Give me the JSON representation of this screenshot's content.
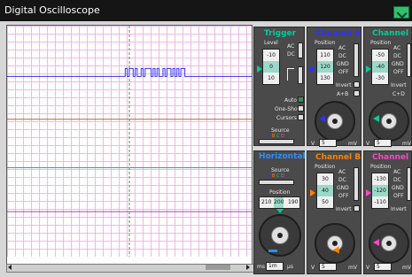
{
  "window": {
    "title": "Digital Oscilloscope"
  },
  "colors": {
    "channel_a": "#3030ff",
    "channel_b": "#ff8000",
    "channel_c": "#00cc99",
    "channel_d": "#ff44cc",
    "horizontal": "#2a8fff",
    "trigger": "#00cc99",
    "grid": "#f2b6e8"
  },
  "trigger": {
    "title": "Trigger",
    "level_label": "Level",
    "ac": "AC",
    "dc": "DC",
    "values": [
      "-10",
      "0",
      "10"
    ],
    "auto": "Auto",
    "one_shot": "One-Shot",
    "cursors": "Cursors",
    "source_label": "Source",
    "source_letters": [
      "A",
      "B",
      "C",
      "D"
    ]
  },
  "channel_a": {
    "title": "Channel A",
    "position_label": "Position",
    "values": [
      "110",
      "120",
      "130"
    ],
    "ac": "AC",
    "dc": "DC",
    "gnd": "GND",
    "off": "OFF",
    "invert": "Invert",
    "combine": "A+B",
    "unit_v": "V",
    "unit_value": "5",
    "unit_mv": "mV",
    "dial": [
      "0.2",
      "0.5",
      "1",
      "2",
      "5",
      "10",
      "20",
      "50",
      "100",
      "200",
      "500",
      "1",
      "2",
      "5",
      "10",
      "20"
    ]
  },
  "channel_b": {
    "title": "Channel B",
    "position_label": "Position",
    "values": [
      "30",
      "40",
      "50"
    ],
    "ac": "AC",
    "dc": "DC",
    "gnd": "GND",
    "off": "OFF",
    "invert": "Invert",
    "unit_v": "V",
    "unit_value": "5",
    "unit_mv": "mV",
    "dial": [
      "0.2",
      "0.5",
      "1",
      "2",
      "5",
      "10",
      "20",
      "50",
      "100",
      "200",
      "500",
      "1",
      "2",
      "5",
      "10",
      "20"
    ]
  },
  "channel_c": {
    "title": "Channel C",
    "position_label": "Position",
    "values": [
      "-50",
      "-40",
      "-30"
    ],
    "ac": "AC",
    "dc": "DC",
    "gnd": "GND",
    "off": "OFF",
    "invert": "Invert",
    "combine": "C+D",
    "unit_v": "V",
    "unit_value": "5",
    "unit_mv": "mV",
    "dial": [
      "0.2",
      "0.5",
      "1",
      "2",
      "5",
      "10",
      "20",
      "50",
      "100",
      "200",
      "500",
      "1",
      "2",
      "5",
      "10",
      "20"
    ]
  },
  "channel_d": {
    "title": "Channel D",
    "position_label": "Position",
    "values": [
      "-130",
      "-120",
      "-110"
    ],
    "ac": "AC",
    "dc": "DC",
    "gnd": "GND",
    "off": "OFF",
    "invert": "Invert",
    "unit_v": "V",
    "unit_value": "5",
    "unit_mv": "mV",
    "dial": [
      "0.2",
      "0.5",
      "1",
      "2",
      "5",
      "10",
      "20",
      "50",
      "100",
      "200",
      "500",
      "1",
      "2",
      "5",
      "10",
      "20"
    ]
  },
  "horizontal": {
    "title": "Horizontal",
    "source_label": "Source",
    "source_letters": [
      "A",
      "B",
      "C",
      "D"
    ],
    "position_label": "Position",
    "position_values": [
      "210",
      "200",
      "190"
    ],
    "unit_ms": "ms",
    "unit_value": "1m",
    "unit_us": "µs",
    "dial": [
      "0.5",
      "1",
      "2",
      "5",
      "10",
      "20",
      "50",
      "100",
      "200",
      "500",
      "1",
      "2",
      "5",
      "10",
      "20",
      "50",
      "100",
      "200",
      "500"
    ]
  },
  "traces": {
    "channel_a_level_fraction": 0.22,
    "channel_b_level_fraction": 0.405,
    "channel_c_level_fraction": 0.615,
    "channel_d_level_fraction": 0.805,
    "burst_start_fraction": 0.475,
    "burst_end_fraction": 0.735,
    "cursor_fraction": 0.5
  }
}
